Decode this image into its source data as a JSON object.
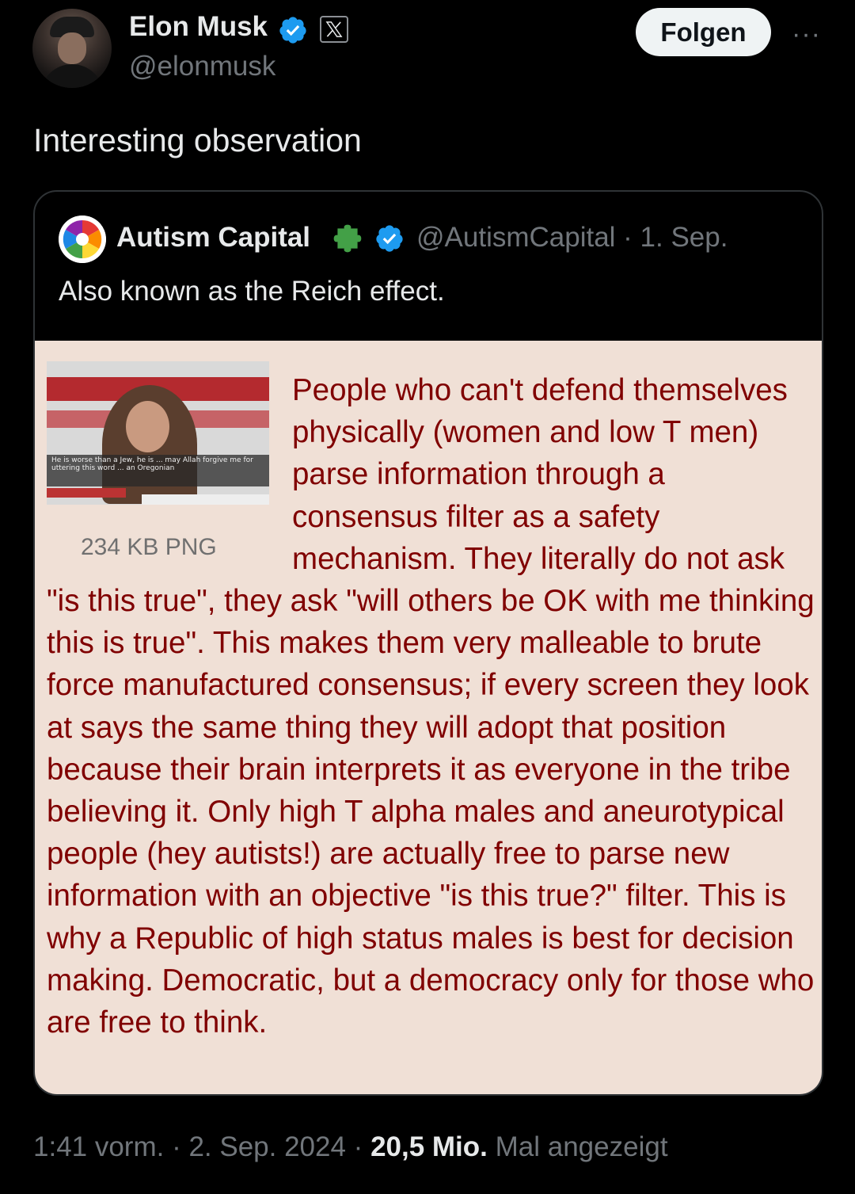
{
  "author": {
    "name": "Elon Musk",
    "handle": "@elonmusk",
    "follow_label": "Folgen",
    "more_label": "···"
  },
  "tweet": {
    "text": "Interesting observation"
  },
  "quote": {
    "name": "Autism Capital",
    "handle_date": "@AutismCapital · 1. Sep.",
    "text": "Also known as the Reich effect.",
    "image": {
      "thumb_caption": "He is worse than a Jew, he is ... may Allah forgive me for uttering this word ... an Oregonian",
      "file_size": "234 KB PNG",
      "post_text": "People who can't defend themselves physically (women and low T men) parse information through a consensus filter as a safety mechanism. They literally do not ask \"is this true\", they ask \"will others be OK with me thinking this is true\". This makes them very malleable to brute force manufactured consensus; if every screen they look at says the same thing they will adopt that position because their brain interprets it as everyone in the tribe believing it. Only high T alpha males and aneurotypical people (hey autists!) are actually free to parse new information with an objective \"is this true?\" filter. This is why a Republic of high status males is best for decision making. Democratic, but a democracy only for those who are free to think."
    }
  },
  "footer": {
    "time_date": "1:41 vorm. · 2. Sep. 2024 ·",
    "views": "20,5 Mio.",
    "views_suffix": "Mal angezeigt"
  },
  "colors": {
    "background": "#000000",
    "verified": "#1d9bf0",
    "follow_button": "#eff3f4",
    "secondary_text": "#71767b",
    "image_background": "#f0e0d6",
    "image_text": "#800000"
  }
}
